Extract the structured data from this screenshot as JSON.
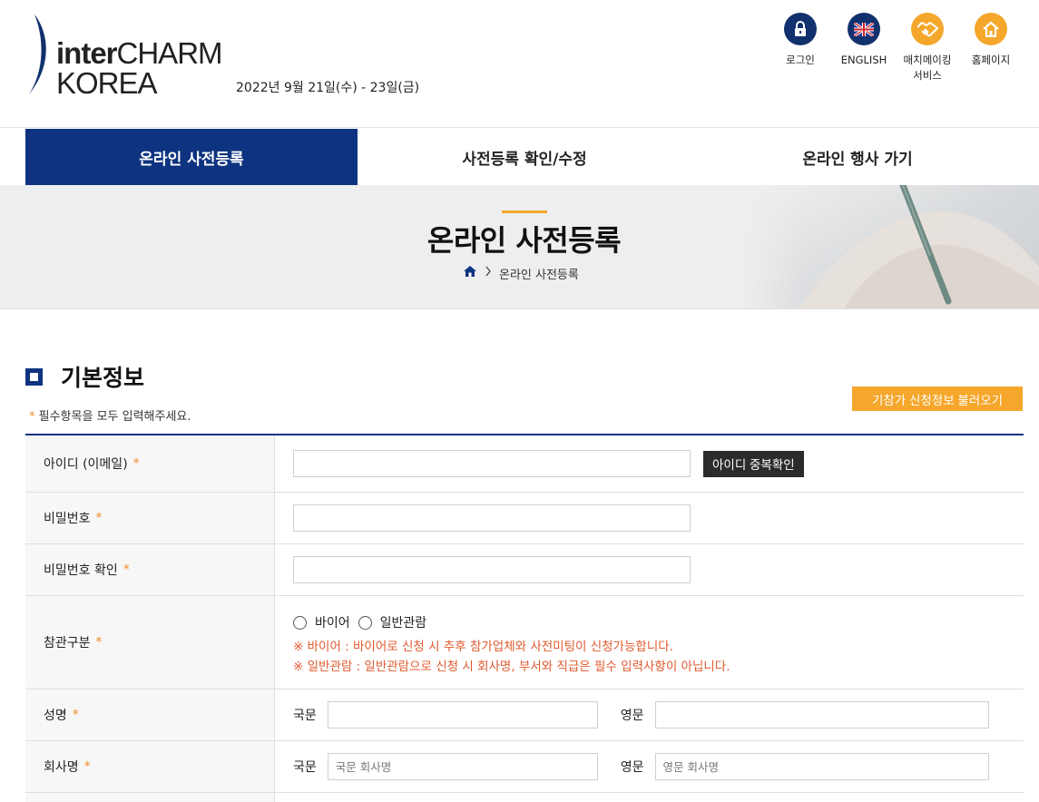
{
  "header": {
    "logo_inter": "inter",
    "logo_charm": "CHARM",
    "logo_korea": "KOREA",
    "event_date": "2022년 9월 21일(수) - 23일(금)",
    "utility": [
      {
        "label": "로그인",
        "icon": "lock-icon",
        "color": "#11306e"
      },
      {
        "label": "ENGLISH",
        "icon": "uk-flag-icon",
        "color": "#11306e"
      },
      {
        "label": "매치메이킹 서비스",
        "icon": "handshake-icon",
        "color": "#f5a72b"
      },
      {
        "label": "홈페이지",
        "icon": "home-icon",
        "color": "#f5a72b"
      }
    ]
  },
  "tabs": [
    {
      "label": "온라인 사전등록",
      "active": true
    },
    {
      "label": "사전등록 확인/수정",
      "active": false
    },
    {
      "label": "온라인 행사 가기",
      "active": false
    }
  ],
  "banner": {
    "title": "온라인 사전등록",
    "breadcrumb_current": "온라인 사전등록"
  },
  "section": {
    "title": "기본정보",
    "required_note_star": "*",
    "required_note": "필수항목을 모두 입력해주세요.",
    "load_button": "기참가 신청정보 불러오기"
  },
  "form": {
    "required_mark": "*",
    "id_label": "아이디 (이메일)",
    "id_value": "",
    "id_check_button": "아이디 중복확인",
    "password_label": "비밀번호",
    "password_confirm_label": "비밀번호 확인",
    "visit_type_label": "참관구분",
    "visit_options": [
      "바이어",
      "일반관람"
    ],
    "notice_buyer": "※ 바이어 : 바이어로 신청 시 추후 참가업체와 사전미팅이 신청가능합니다.",
    "notice_general": "※ 일반관람 : 일반관람으로 신청 시 회사명, 부서와 직급은 필수 입력사항이 아닙니다.",
    "name_label": "성명",
    "korean_label": "국문",
    "english_label": "영문",
    "company_label": "회사명",
    "company_ko_placeholder": "국문 회사명",
    "company_en_placeholder": "영문 회사명"
  },
  "colors": {
    "navy": "#0e3380",
    "orange": "#f5a72b",
    "notice_red": "#e05a2e"
  }
}
